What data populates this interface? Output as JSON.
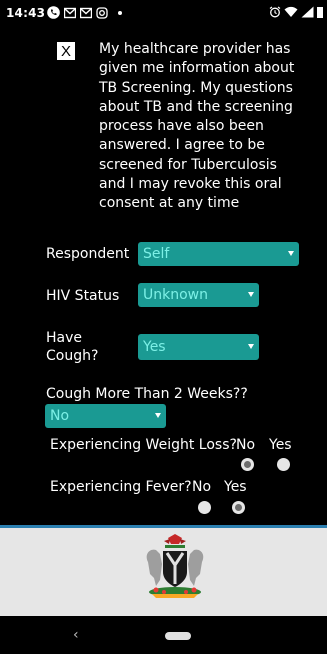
{
  "status_bar": {
    "time": "14:43",
    "icons": [
      "phone-icon",
      "mail-icon",
      "mail-icon",
      "instagram-icon",
      "dot-icon",
      "alarm-icon",
      "wifi-icon",
      "signal-icon",
      "battery-icon"
    ]
  },
  "consent": {
    "checkbox_mark": "X",
    "text": "My healthcare provider has given me information about TB Screening. My questions about TB and the screening process have also been answered. I agree to be screened for Tuberculosis and I may revoke this oral consent at any time"
  },
  "form": {
    "respondent": {
      "label": "Respondent",
      "value": "Self"
    },
    "hiv_status": {
      "label": "HIV Status",
      "value": "Unknown"
    },
    "have_cough": {
      "label": "Have Cough?",
      "value": "Yes"
    },
    "cough_more": {
      "label": "Cough More Than 2 Weeks??",
      "value": "No"
    },
    "weight_loss": {
      "label": "Experiencing Weight Loss?",
      "options": [
        "No",
        "Yes"
      ],
      "selected": "No"
    },
    "fever": {
      "label": "Experiencing Fever?",
      "options": [
        "No",
        "Yes"
      ],
      "selected": "Yes"
    }
  },
  "footer": {
    "emblem": "coat-of-arms-icon"
  },
  "nav": {
    "back_glyph": "‹"
  },
  "colors": {
    "select_bg": "#1a9a93",
    "select_text": "#7cf0e6",
    "footer_bg": "#e6e6e6",
    "accent_line": "#2b7fb0"
  }
}
